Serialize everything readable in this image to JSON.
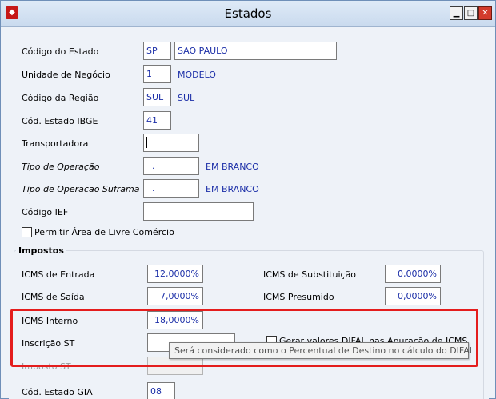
{
  "window": {
    "title": "Estados",
    "app_icon": "app-icon"
  },
  "fields": {
    "codigo_estado": {
      "label": "Código do Estado",
      "value": "SP",
      "description": "SAO PAULO"
    },
    "unidade_negocio": {
      "label": "Unidade de Negócio",
      "value": "1",
      "description": "MODELO"
    },
    "codigo_regiao": {
      "label": "Código da Região",
      "value": "SUL",
      "description": "SUL"
    },
    "cod_estado_ibge": {
      "label": "Cód. Estado IBGE",
      "value": "41"
    },
    "transportadora": {
      "label": "Transportadora",
      "value": ""
    },
    "tipo_operacao": {
      "label": "Tipo de Operação",
      "value": ".",
      "description": "EM BRANCO"
    },
    "tipo_operacao_suframa": {
      "label": "Tipo de Operacao Suframa",
      "value": ".",
      "description": "EM BRANCO"
    },
    "codigo_ief": {
      "label": "Código IEF",
      "value": ""
    },
    "permitir_area": {
      "label": "Permitir Área de Livre Comércio",
      "checked": false
    }
  },
  "impostos": {
    "group_title": "Impostos",
    "icms_entrada": {
      "label": "ICMS de Entrada",
      "value": "12,0000%"
    },
    "icms_saida": {
      "label": "ICMS de Saída",
      "value": "7,0000%"
    },
    "icms_interno": {
      "label": "ICMS Interno",
      "value": "18,0000%"
    },
    "inscricao_st": {
      "label": "Inscrição ST",
      "value": ""
    },
    "imposto_st": {
      "label": "Imposto ST",
      "value": ""
    },
    "cod_estado_gia": {
      "label": "Cód. Estado GIA",
      "value": "08"
    },
    "icms_substituicao": {
      "label": "ICMS de Substituição",
      "value": "0,0000%"
    },
    "icms_presumido": {
      "label": "ICMS Presumido",
      "value": "0,0000%"
    },
    "gerar_difal": {
      "label": "Gerar valores DIFAL nas Apuração de ICMS",
      "checked": false
    }
  },
  "tooltip": {
    "text": "Será considerado como o Percentual de Destino no cálculo do DIFAL"
  },
  "colors": {
    "highlight": "#e41d1d",
    "value_text": "#1c2fa8",
    "close_button": "#d23b2c"
  }
}
